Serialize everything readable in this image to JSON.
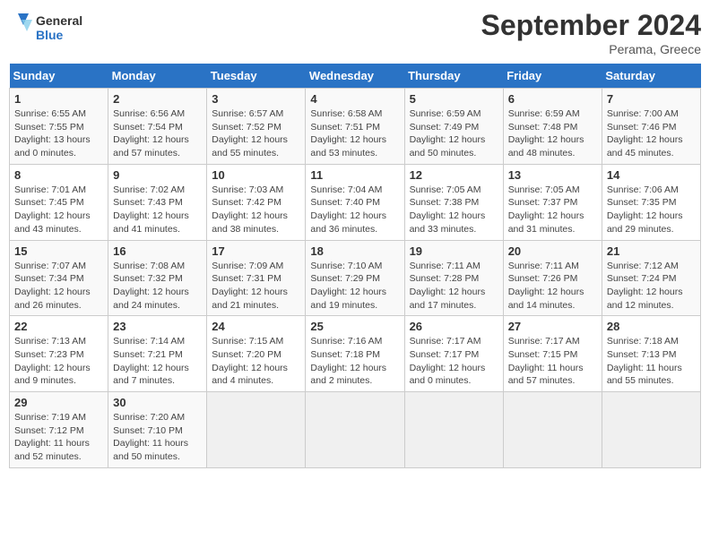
{
  "header": {
    "logo_line1": "General",
    "logo_line2": "Blue",
    "month": "September 2024",
    "location": "Perama, Greece"
  },
  "weekdays": [
    "Sunday",
    "Monday",
    "Tuesday",
    "Wednesday",
    "Thursday",
    "Friday",
    "Saturday"
  ],
  "weeks": [
    [
      {
        "day": "1",
        "info": "Sunrise: 6:55 AM\nSunset: 7:55 PM\nDaylight: 13 hours\nand 0 minutes."
      },
      {
        "day": "2",
        "info": "Sunrise: 6:56 AM\nSunset: 7:54 PM\nDaylight: 12 hours\nand 57 minutes."
      },
      {
        "day": "3",
        "info": "Sunrise: 6:57 AM\nSunset: 7:52 PM\nDaylight: 12 hours\nand 55 minutes."
      },
      {
        "day": "4",
        "info": "Sunrise: 6:58 AM\nSunset: 7:51 PM\nDaylight: 12 hours\nand 53 minutes."
      },
      {
        "day": "5",
        "info": "Sunrise: 6:59 AM\nSunset: 7:49 PM\nDaylight: 12 hours\nand 50 minutes."
      },
      {
        "day": "6",
        "info": "Sunrise: 6:59 AM\nSunset: 7:48 PM\nDaylight: 12 hours\nand 48 minutes."
      },
      {
        "day": "7",
        "info": "Sunrise: 7:00 AM\nSunset: 7:46 PM\nDaylight: 12 hours\nand 45 minutes."
      }
    ],
    [
      {
        "day": "8",
        "info": "Sunrise: 7:01 AM\nSunset: 7:45 PM\nDaylight: 12 hours\nand 43 minutes."
      },
      {
        "day": "9",
        "info": "Sunrise: 7:02 AM\nSunset: 7:43 PM\nDaylight: 12 hours\nand 41 minutes."
      },
      {
        "day": "10",
        "info": "Sunrise: 7:03 AM\nSunset: 7:42 PM\nDaylight: 12 hours\nand 38 minutes."
      },
      {
        "day": "11",
        "info": "Sunrise: 7:04 AM\nSunset: 7:40 PM\nDaylight: 12 hours\nand 36 minutes."
      },
      {
        "day": "12",
        "info": "Sunrise: 7:05 AM\nSunset: 7:38 PM\nDaylight: 12 hours\nand 33 minutes."
      },
      {
        "day": "13",
        "info": "Sunrise: 7:05 AM\nSunset: 7:37 PM\nDaylight: 12 hours\nand 31 minutes."
      },
      {
        "day": "14",
        "info": "Sunrise: 7:06 AM\nSunset: 7:35 PM\nDaylight: 12 hours\nand 29 minutes."
      }
    ],
    [
      {
        "day": "15",
        "info": "Sunrise: 7:07 AM\nSunset: 7:34 PM\nDaylight: 12 hours\nand 26 minutes."
      },
      {
        "day": "16",
        "info": "Sunrise: 7:08 AM\nSunset: 7:32 PM\nDaylight: 12 hours\nand 24 minutes."
      },
      {
        "day": "17",
        "info": "Sunrise: 7:09 AM\nSunset: 7:31 PM\nDaylight: 12 hours\nand 21 minutes."
      },
      {
        "day": "18",
        "info": "Sunrise: 7:10 AM\nSunset: 7:29 PM\nDaylight: 12 hours\nand 19 minutes."
      },
      {
        "day": "19",
        "info": "Sunrise: 7:11 AM\nSunset: 7:28 PM\nDaylight: 12 hours\nand 17 minutes."
      },
      {
        "day": "20",
        "info": "Sunrise: 7:11 AM\nSunset: 7:26 PM\nDaylight: 12 hours\nand 14 minutes."
      },
      {
        "day": "21",
        "info": "Sunrise: 7:12 AM\nSunset: 7:24 PM\nDaylight: 12 hours\nand 12 minutes."
      }
    ],
    [
      {
        "day": "22",
        "info": "Sunrise: 7:13 AM\nSunset: 7:23 PM\nDaylight: 12 hours\nand 9 minutes."
      },
      {
        "day": "23",
        "info": "Sunrise: 7:14 AM\nSunset: 7:21 PM\nDaylight: 12 hours\nand 7 minutes."
      },
      {
        "day": "24",
        "info": "Sunrise: 7:15 AM\nSunset: 7:20 PM\nDaylight: 12 hours\nand 4 minutes."
      },
      {
        "day": "25",
        "info": "Sunrise: 7:16 AM\nSunset: 7:18 PM\nDaylight: 12 hours\nand 2 minutes."
      },
      {
        "day": "26",
        "info": "Sunrise: 7:17 AM\nSunset: 7:17 PM\nDaylight: 12 hours\nand 0 minutes."
      },
      {
        "day": "27",
        "info": "Sunrise: 7:17 AM\nSunset: 7:15 PM\nDaylight: 11 hours\nand 57 minutes."
      },
      {
        "day": "28",
        "info": "Sunrise: 7:18 AM\nSunset: 7:13 PM\nDaylight: 11 hours\nand 55 minutes."
      }
    ],
    [
      {
        "day": "29",
        "info": "Sunrise: 7:19 AM\nSunset: 7:12 PM\nDaylight: 11 hours\nand 52 minutes."
      },
      {
        "day": "30",
        "info": "Sunrise: 7:20 AM\nSunset: 7:10 PM\nDaylight: 11 hours\nand 50 minutes."
      },
      {
        "day": "",
        "info": ""
      },
      {
        "day": "",
        "info": ""
      },
      {
        "day": "",
        "info": ""
      },
      {
        "day": "",
        "info": ""
      },
      {
        "day": "",
        "info": ""
      }
    ]
  ]
}
